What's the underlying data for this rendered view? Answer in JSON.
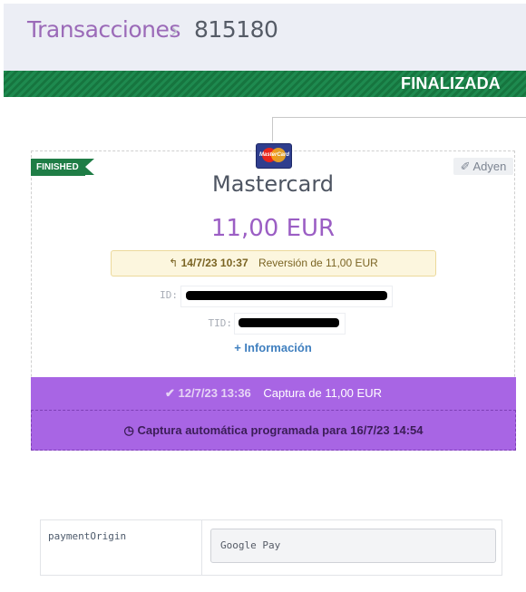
{
  "header": {
    "section": "Transacciones",
    "separator": ">",
    "transaction_id": "815180"
  },
  "status": {
    "label": "FINALIZADA",
    "color": "#1e8a4f"
  },
  "card": {
    "state_badge": "FINISHED",
    "processor": "Adyen",
    "processor_icon": "plug-icon",
    "brand": "Mastercard",
    "brand_logo_text": "MasterCard",
    "amount": "11,00 EUR",
    "reversal": {
      "icon": "reply-arrow-icon",
      "timestamp": "14/7/23 10:37",
      "text": "Reversión de 11,00 EUR"
    },
    "id_label": "ID:",
    "tid_label": "TID:",
    "info_link": "Información",
    "info_icon": "plus-icon"
  },
  "capture": {
    "icon": "check-icon",
    "timestamp": "12/7/23 13:36",
    "text": "Captura de  11,00 EUR"
  },
  "auto_capture": {
    "icon": "clock-icon",
    "text": "Captura automática programada para 16/7/23 14:54"
  },
  "metadata": {
    "rows": [
      {
        "key": "paymentOrigin",
        "value": "Google Pay"
      }
    ]
  },
  "colors": {
    "accent": "#9b5ec4",
    "capture_bg": "#a865e4",
    "reversal_bg": "#fcf6de"
  }
}
